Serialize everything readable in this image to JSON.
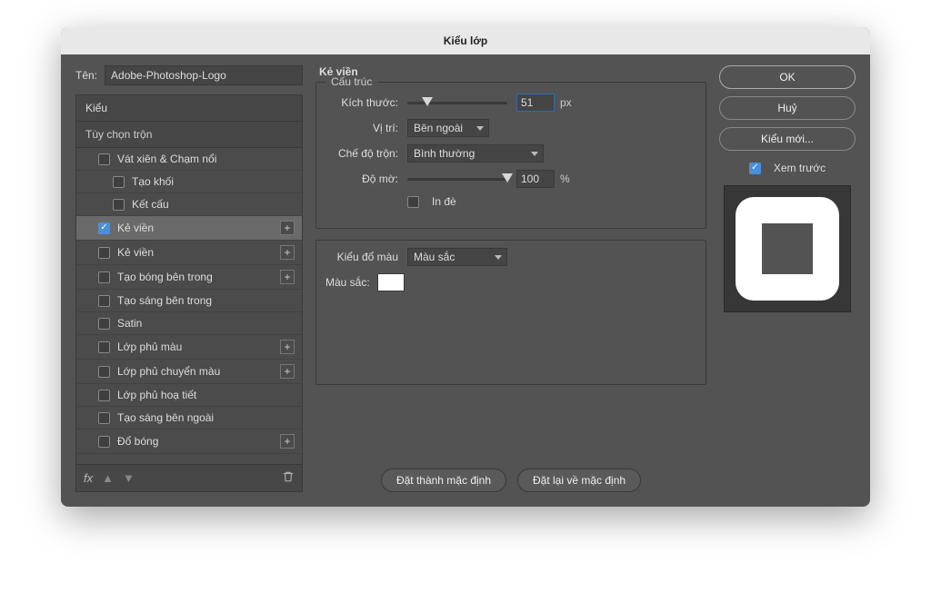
{
  "title": "Kiểu lớp",
  "name_label": "Tên:",
  "name_value": "Adobe-Photoshop-Logo",
  "panel": {
    "head": "Kiểu",
    "section": "Tùy chọn trộn",
    "items": [
      {
        "label": "Vát xiên & Chạm nổi",
        "checked": false,
        "indent": 1,
        "plus": false
      },
      {
        "label": "Tạo khối",
        "checked": false,
        "indent": 2,
        "plus": false
      },
      {
        "label": "Kết cấu",
        "checked": false,
        "indent": 2,
        "plus": false
      },
      {
        "label": "Kẻ viền",
        "checked": true,
        "indent": 1,
        "plus": true,
        "selected": true
      },
      {
        "label": "Kẻ viền",
        "checked": false,
        "indent": 1,
        "plus": true
      },
      {
        "label": "Tạo bóng bên trong",
        "checked": false,
        "indent": 1,
        "plus": true
      },
      {
        "label": "Tạo sáng bên trong",
        "checked": false,
        "indent": 1,
        "plus": false
      },
      {
        "label": "Satin",
        "checked": false,
        "indent": 1,
        "plus": false
      },
      {
        "label": "Lớp phủ màu",
        "checked": false,
        "indent": 1,
        "plus": true
      },
      {
        "label": "Lớp phủ chuyển màu",
        "checked": false,
        "indent": 1,
        "plus": true
      },
      {
        "label": "Lớp phủ hoạ tiết",
        "checked": false,
        "indent": 1,
        "plus": false
      },
      {
        "label": "Tạo sáng bên ngoài",
        "checked": false,
        "indent": 1,
        "plus": false
      },
      {
        "label": "Đổ bóng",
        "checked": false,
        "indent": 1,
        "plus": true
      }
    ],
    "fx": "fx"
  },
  "center": {
    "heading": "Kẻ viền",
    "structure_title": "Cấu trúc",
    "size_label": "Kích thước:",
    "size_value": "51",
    "size_unit": "px",
    "position_label": "Vị trí:",
    "position_value": "Bên ngoài",
    "blend_label": "Chế độ trộn:",
    "blend_value": "Bình thường",
    "opacity_label": "Độ mờ:",
    "opacity_value": "100",
    "opacity_unit": "%",
    "overprint_label": "In đè",
    "filltype_title": "",
    "filltype_label": "Kiểu đổ màu",
    "filltype_value": "Màu sắc",
    "color_label": "Màu sắc:",
    "set_default": "Đặt thành mặc định",
    "reset_default": "Đặt lại về mặc định"
  },
  "right": {
    "ok": "OK",
    "cancel": "Huỷ",
    "newstyle": "Kiểu mới...",
    "preview": "Xem trước"
  }
}
